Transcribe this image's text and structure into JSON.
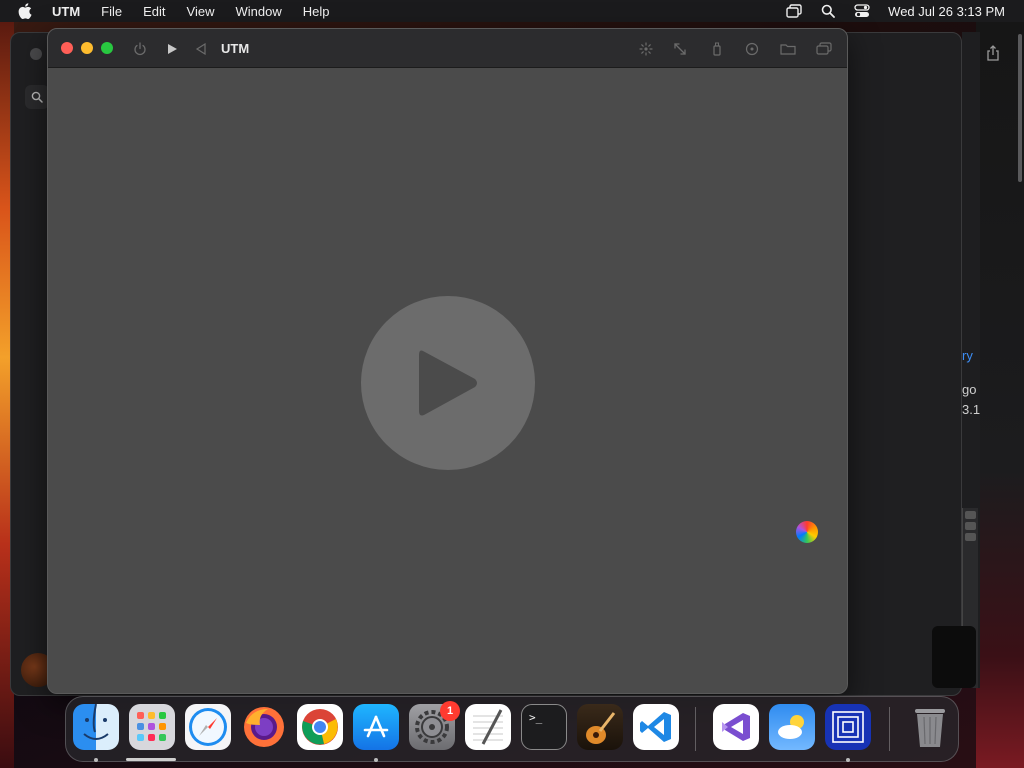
{
  "menubar": {
    "app_name": "UTM",
    "items": [
      "File",
      "Edit",
      "View",
      "Window",
      "Help"
    ],
    "clock": "Wed Jul 26  3:13 PM"
  },
  "utm_window": {
    "title": "UTM"
  },
  "background_window": {
    "fragments": [
      "ry",
      "go",
      "3.1"
    ]
  },
  "dock": {
    "apps": [
      {
        "name": "Finder",
        "icon": "finder-icon"
      },
      {
        "name": "Launchpad",
        "icon": "launchpad-icon"
      },
      {
        "name": "Safari",
        "icon": "safari-icon"
      },
      {
        "name": "Firefox",
        "icon": "firefox-icon"
      },
      {
        "name": "Google Chrome",
        "icon": "chrome-icon"
      },
      {
        "name": "App Store",
        "icon": "app-store-icon"
      },
      {
        "name": "System Settings",
        "icon": "system-settings-icon"
      },
      {
        "name": "TextEdit",
        "icon": "textedit-icon"
      },
      {
        "name": "Terminal",
        "icon": "terminal-icon"
      },
      {
        "name": "GarageBand",
        "icon": "garageband-icon"
      },
      {
        "name": "Visual Studio Code",
        "icon": "vscode-icon"
      },
      {
        "name": "Visual Studio",
        "icon": "visual-studio-icon"
      },
      {
        "name": "Weather",
        "icon": "weather-icon"
      },
      {
        "name": "UTM",
        "icon": "utm-icon"
      },
      {
        "name": "Trash",
        "icon": "trash-icon"
      }
    ],
    "settings_badge": "1",
    "terminal_prompt": ">_"
  }
}
